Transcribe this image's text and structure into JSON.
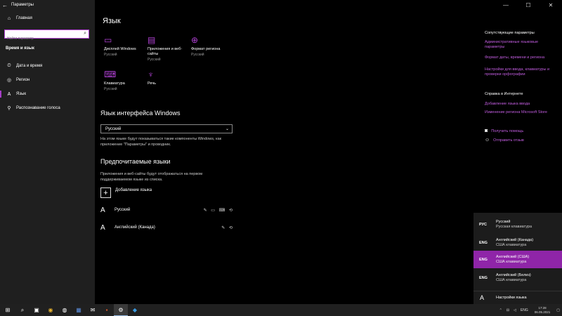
{
  "window": {
    "title": "Параметры",
    "controls": [
      "—",
      "☐",
      "✕"
    ]
  },
  "sidebar": {
    "home": "Главная",
    "search_placeholder": "Найти параметр",
    "section": "Время и язык",
    "items": [
      {
        "label": "Дата и время",
        "icon": "calendar-clock-icon",
        "glyph": "⏲"
      },
      {
        "label": "Регион",
        "icon": "globe-icon",
        "glyph": "◎"
      },
      {
        "label": "Язык",
        "icon": "language-icon",
        "glyph": "A字"
      },
      {
        "label": "Распознавание голоса",
        "icon": "microphone-icon",
        "glyph": "⚲"
      }
    ]
  },
  "main": {
    "title": "Язык",
    "tiles": [
      {
        "label": "Дисплей Windows",
        "sub": "Русский",
        "icon": "display-icon",
        "glyph": "▭"
      },
      {
        "label": "Приложения и веб-сайты",
        "sub": "Русский",
        "icon": "apps-window-icon",
        "glyph": "▤"
      },
      {
        "label": "Формат региона",
        "sub": "Русский",
        "icon": "globe-icon",
        "glyph": "⊕"
      },
      {
        "label": "Клавиатура",
        "sub": "Русский",
        "icon": "keyboard-icon",
        "glyph": "⌨"
      },
      {
        "label": "Речь",
        "sub": "",
        "icon": "microphone-icon",
        "glyph": "🎙"
      }
    ],
    "interface_heading": "Язык интерфейса Windows",
    "interface_value": "Русский",
    "interface_desc": "На этом языке будут показываться такие компоненты Windows, как приложение \"Параметры\" и проводник.",
    "preferred_heading": "Предпочитаемые языки",
    "preferred_desc": "Приложения и веб-сайты будут отображаться на первом поддерживаемом языке из списка.",
    "add_label": "Добавление языка",
    "languages": [
      {
        "name": "Русский",
        "features": "✎ ▭ ⌨ ⟲"
      },
      {
        "name": "Английский (Канада)",
        "features": "✎ ⟲"
      }
    ]
  },
  "right": {
    "related_heading": "Сопутствующие параметры",
    "related_links": [
      "Административные языковые параметры",
      "Формат даты, времени и региона",
      "Настройки для ввода, клавиатуры и проверки орфографии"
    ],
    "web_heading": "Справка в Интернете",
    "web_links": [
      "Добавление языка ввода",
      "Изменение региона Microsoft Store"
    ],
    "help": "Получить помощь",
    "feedback": "Отправить отзыв"
  },
  "flyout": {
    "items": [
      {
        "code": "РУС",
        "line1": "Русский",
        "line2": "Русская клавиатура",
        "selected": false
      },
      {
        "code": "ENG",
        "line1": "Английский (Канада)",
        "line2": "США клавиатура",
        "selected": false
      },
      {
        "code": "ENG",
        "line1": "Английский (США)",
        "line2": "США клавиатура",
        "selected": true
      },
      {
        "code": "ENG",
        "line1": "Английский (Белиз)",
        "line2": "США клавиатура",
        "selected": false
      }
    ],
    "settings": "Настройки языка"
  },
  "taskbar": {
    "lang": "ENG",
    "time": "17:28",
    "date": "06.05.2021"
  },
  "colors": {
    "accent": "#b041d4",
    "link": "#c25de0",
    "selected": "#8f25a8"
  }
}
